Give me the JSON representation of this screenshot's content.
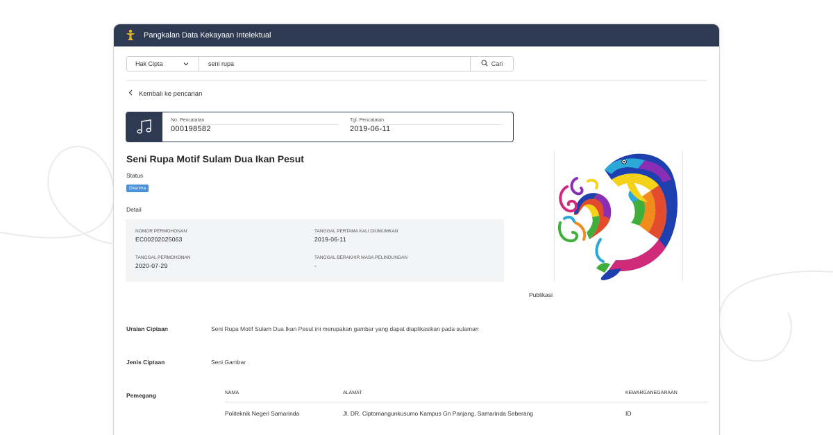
{
  "titlebar": {
    "title": "Pangkalan Data Kekayaan Intelektual"
  },
  "search": {
    "category": "Hak Cipta",
    "query": "seni rupa",
    "button_label": "Cari"
  },
  "nav": {
    "back_label": "Kembali ke pencarian"
  },
  "record": {
    "no_label": "No. Pencatatan",
    "no_value": "000198582",
    "date_label": "Tgl. Pencatatan",
    "date_value": "2019-06-11"
  },
  "work": {
    "title": "Seni Rupa Motif Sulam Dua Ikan Pesut",
    "status_label": "Status",
    "status_value": "Diterima",
    "detail_label": "Detail",
    "publication_label": "Publikasi"
  },
  "details": {
    "app_no_label": "NOMOR PERMOHONAN",
    "app_no_value": "EC00202025063",
    "first_pub_label": "TANGGAL PERTAMA KALI DIUMUMKAN",
    "first_pub_value": "2019-06-11",
    "app_date_label": "TANGGAL PERMOHONAN",
    "app_date_value": "2020-07-29",
    "end_label": "TANGGAL BERAKHIR MASA PELINDUNGAN",
    "end_value": "-"
  },
  "description": {
    "label": "Uraian Ciptaan",
    "value": "Seni Rupa Motif Sulam Dua Ikan Pesut ini merupakan gambar yang dapat diaplikasikan pada sulaman"
  },
  "type": {
    "label": "Jenis Ciptaan",
    "value": "Seni Gambar"
  },
  "owners": {
    "label": "Pemegang",
    "columns": [
      "NAMA",
      "ALAMAT",
      "KEWARGANEGARAAN"
    ],
    "rows": [
      {
        "name": "Politeknik Negeri Samarinda",
        "address": "Jl. DR. Ciptomangunkusumo Kampus Gn Panjang, Samarinda Seberang",
        "citizenship": "ID"
      }
    ]
  },
  "colors": {
    "header_bg": "#2e3a52",
    "badge": "#4a90d9",
    "detail_bg": "#f3f4f6"
  },
  "icons": [
    "logo-emblem-icon",
    "chevron-down-icon",
    "search-icon",
    "chevron-left-icon",
    "music-note-icon"
  ]
}
